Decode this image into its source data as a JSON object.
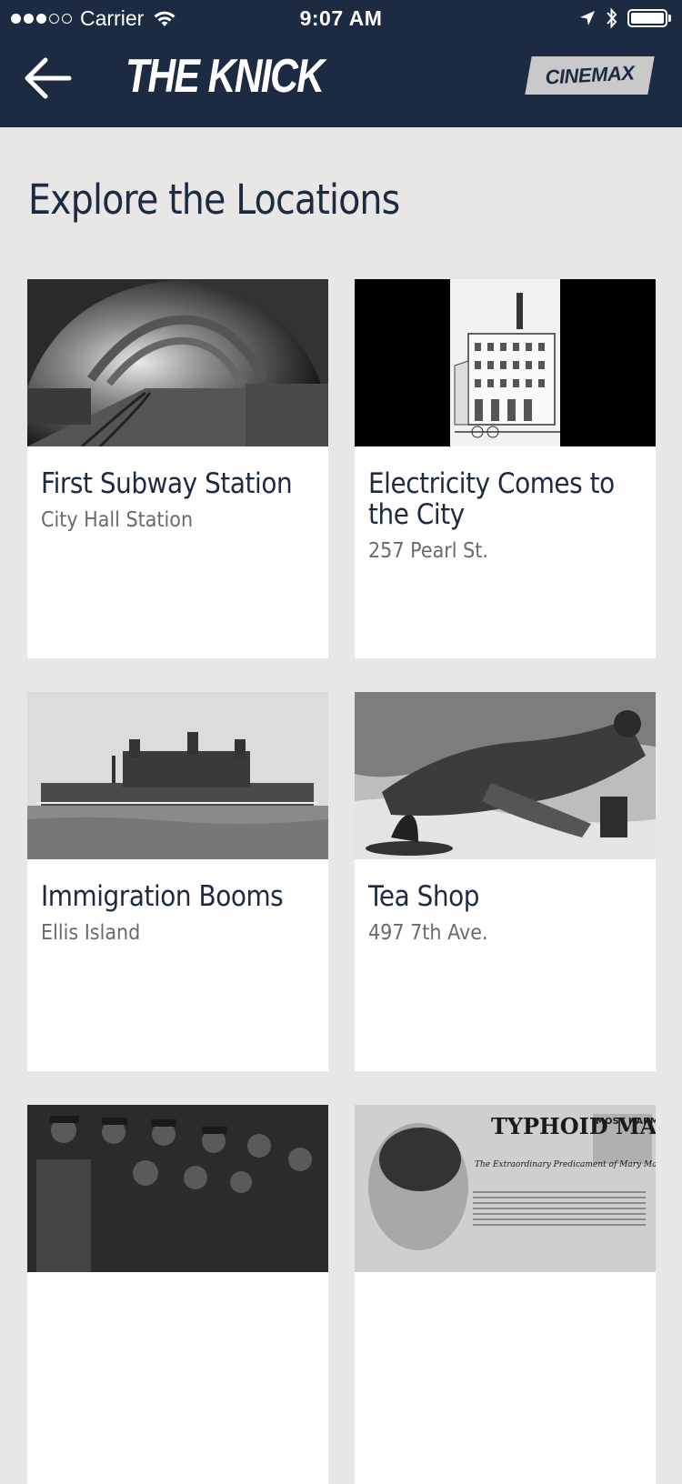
{
  "status_bar": {
    "carrier": "Carrier",
    "time": "9:07 AM",
    "signal_dots": [
      true,
      true,
      true,
      false,
      false
    ]
  },
  "header": {
    "app_title": "THE KNICK",
    "network_logo": "CINEMAX",
    "back_icon": "arrow-left-icon",
    "background": "#1c2b41"
  },
  "page": {
    "title": "Explore the Locations"
  },
  "locations": [
    {
      "title": "First Subway Station",
      "subtitle": "City Hall Station"
    },
    {
      "title": "Electricity Comes to the City",
      "subtitle": "257 Pearl St."
    },
    {
      "title": "Immigration Booms",
      "subtitle": "Ellis Island"
    },
    {
      "title": "Tea Shop",
      "subtitle": "497 7th Ave."
    },
    {
      "title": "",
      "subtitle": ""
    },
    {
      "title": "",
      "subtitle": "",
      "image_text": [
        "TYPHOID MARY",
        "MOST HARM",
        "The Extraordinary Predicament of Mary Mallon, a Prisoner on New York's Quarantine Hospital"
      ]
    }
  ],
  "colors": {
    "navy": "#1c2b41",
    "page_bg": "#e8e7e5",
    "subtitle": "#6a6a6a"
  }
}
